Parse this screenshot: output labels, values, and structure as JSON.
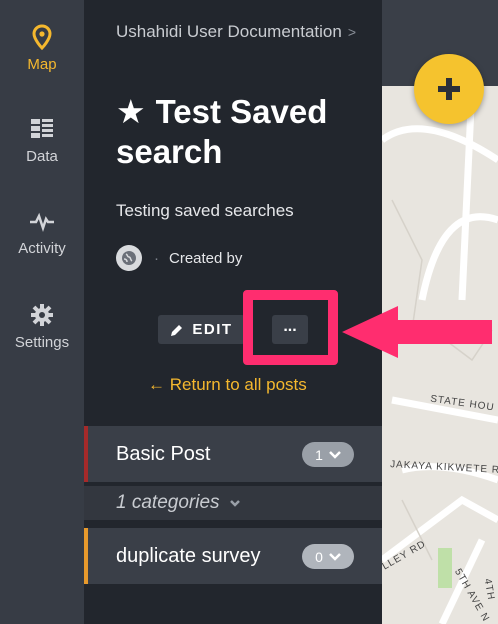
{
  "rail": {
    "items": [
      {
        "label": "Map",
        "icon": "map-pin-icon",
        "active": true
      },
      {
        "label": "Data",
        "icon": "data-grid-icon",
        "active": false
      },
      {
        "label": "Activity",
        "icon": "activity-pulse-icon",
        "active": false
      },
      {
        "label": "Settings",
        "icon": "gear-icon",
        "active": false
      }
    ]
  },
  "panel": {
    "breadcrumb": "Ushahidi User Documentation",
    "breadcrumb_sep": ">",
    "title": "Test Saved search",
    "description": "Testing saved searches",
    "creator_separator": "·",
    "created_by": "Created by",
    "edit_label": "EDIT",
    "more_label": "...",
    "return_label": "Return to all posts"
  },
  "surveys": [
    {
      "name": "Basic Post",
      "count": "1",
      "color": "#a52a2a"
    },
    {
      "name": "1 categories"
    },
    {
      "name": "duplicate survey",
      "count": "0",
      "color": "#e89a2c"
    }
  ],
  "map": {
    "streets": [
      "STATE HOU",
      "JAKAYA KIKWETE R",
      "LLEY RD",
      "5TH AVE N",
      "4TH"
    ]
  },
  "colors": {
    "accent": "#f5b82e",
    "highlight": "#ff2d6f"
  }
}
